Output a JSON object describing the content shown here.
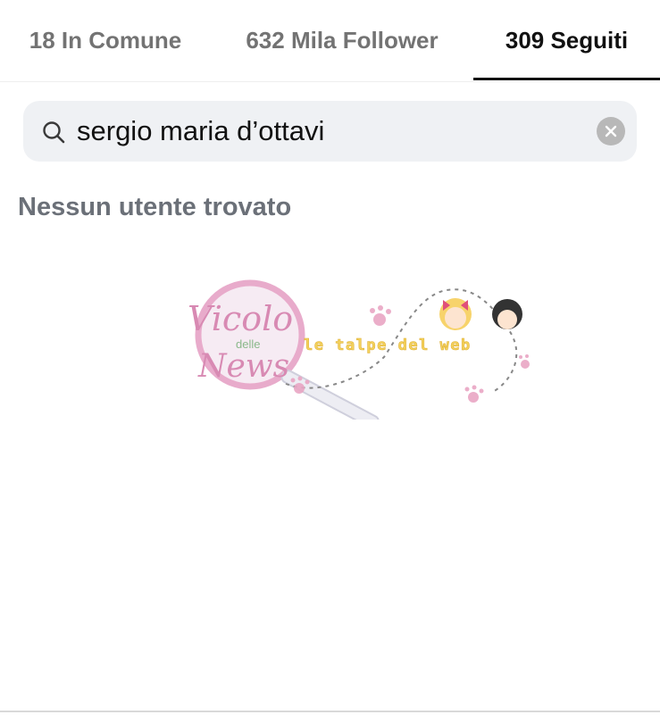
{
  "tabs": {
    "mutual": "18 In Comune",
    "followers": "632 Mila Follower",
    "following": "309 Seguiti"
  },
  "search": {
    "value": "sergio maria d’ottavi",
    "icon": "search-icon",
    "clear_icon": "close-icon"
  },
  "results": {
    "empty_message": "Nessun utente trovato"
  },
  "watermark": {
    "logo_text_1": "Vicolo",
    "logo_text_2": "delle",
    "logo_text_3": "News",
    "tagline": "le talpe del web"
  }
}
